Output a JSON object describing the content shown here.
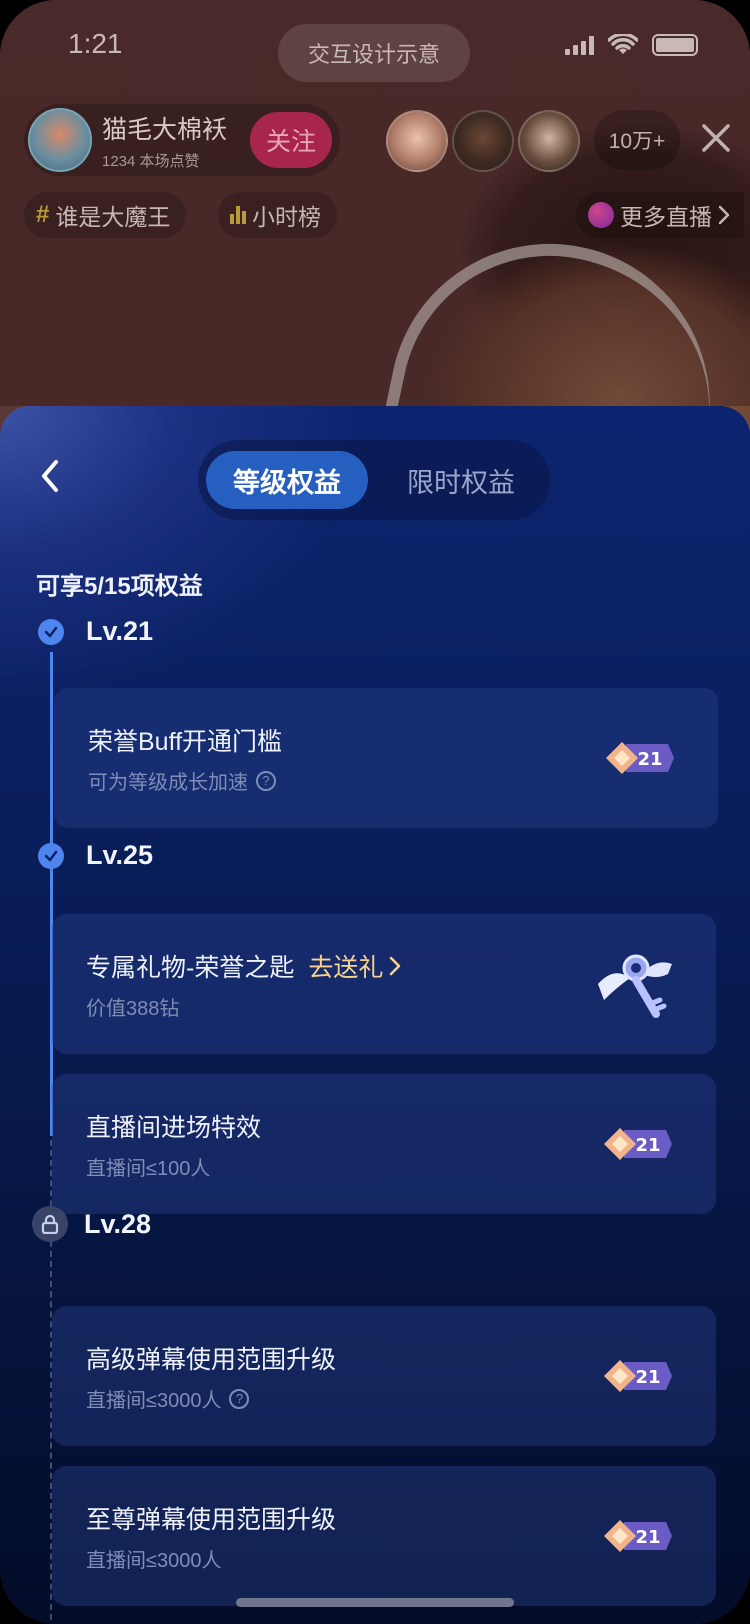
{
  "status_bar": {
    "time": "1:21",
    "center_pill": "交互设计示意"
  },
  "host": {
    "name": "猫毛大棉袄",
    "subtitle": "1234 本场点赞",
    "follow_label": "关注"
  },
  "viewer_count": "10万+",
  "tags": {
    "hashtag_label": "谁是大魔王",
    "rank_label": "小时榜",
    "more_live_label": "更多直播"
  },
  "sheet": {
    "tabs": [
      {
        "label": "等级权益",
        "active": true
      },
      {
        "label": "限时权益",
        "active": false
      }
    ],
    "summary": "可享5/15项权益",
    "levels": [
      {
        "label": "Lv.21",
        "state": "unlocked",
        "icon": "check-icon"
      },
      {
        "label": "Lv.25",
        "state": "unlocked",
        "icon": "check-icon"
      },
      {
        "label": "Lv.28",
        "state": "locked",
        "icon": "lock-icon"
      }
    ],
    "benefits": [
      {
        "title": "荣誉Buff开通门槛",
        "subtitle": "可为等级成长加速",
        "badge": "21",
        "has_help": true
      },
      {
        "title": "专属礼物-荣誉之匙",
        "action": "去送礼",
        "subtitle": "价值388钻",
        "image": "key-gift-icon"
      },
      {
        "title": "直播间进场特效",
        "subtitle": "直播间≤100人",
        "badge": "21"
      },
      {
        "title": "高级弹幕使用范围升级",
        "subtitle": "直播间≤3000人",
        "badge": "21",
        "has_help": true
      },
      {
        "title": "至尊弹幕使用范围升级",
        "subtitle": "直播间≤3000人",
        "badge": "21"
      }
    ]
  },
  "colors": {
    "accent": "#2560c0",
    "timeline": "#4f86ee",
    "gift_link": "#f7d38c",
    "follow_bg": "#a8264e"
  }
}
